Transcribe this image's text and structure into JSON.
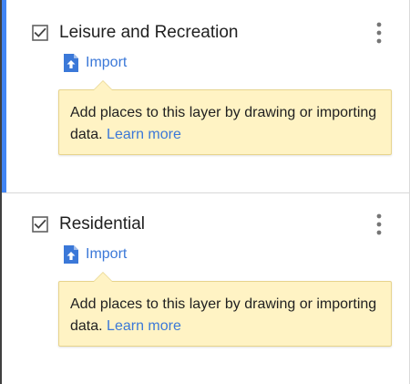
{
  "layers": [
    {
      "title": "Leisure and Recreation",
      "checked": true,
      "selected": true,
      "import_label": "Import",
      "hint_text": "Add places to this layer by drawing or importing data.",
      "hint_link": "Learn more"
    },
    {
      "title": "Residential",
      "checked": true,
      "selected": false,
      "import_label": "Import",
      "hint_text": "Add places to this layer by drawing or importing data.",
      "hint_link": "Learn more"
    }
  ],
  "icons": {
    "checkbox": "checkbox-checked-icon",
    "menu": "more-vert-icon",
    "import": "file-upload-icon"
  },
  "colors": {
    "accent": "#4285f4",
    "link": "#3b78d8",
    "hint_background": "#fff3c4",
    "hint_border": "#e7d48c",
    "text": "#212121"
  }
}
